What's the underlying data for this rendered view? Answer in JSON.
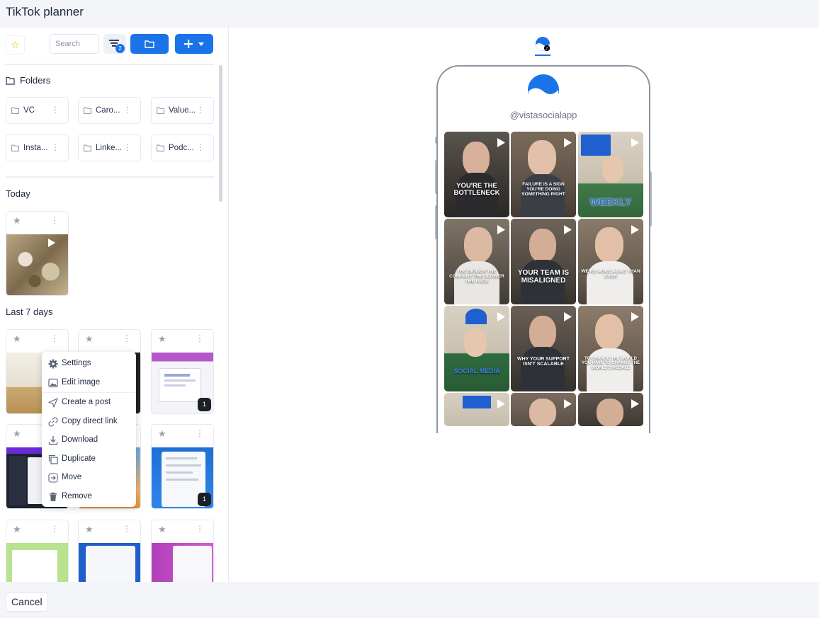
{
  "window": {
    "title": "TikTok planner"
  },
  "toolbar": {
    "search_placeholder": "Search",
    "filter_count": "2"
  },
  "folders_section": {
    "title": "Folders",
    "items": [
      {
        "name": "VC"
      },
      {
        "name": "Caro..."
      },
      {
        "name": "Value..."
      },
      {
        "name": "Insta..."
      },
      {
        "name": "Linke..."
      },
      {
        "name": "Podc..."
      }
    ]
  },
  "today_section": {
    "title": "Today"
  },
  "last7_section": {
    "title": "Last 7 days",
    "badges": [
      "1",
      "1"
    ]
  },
  "context_menu": {
    "items": [
      {
        "label": "Settings",
        "icon": "gear-icon"
      },
      {
        "label": "Edit image",
        "icon": "image-icon"
      },
      {
        "label": "Create a post",
        "icon": "send-icon"
      },
      {
        "label": "Copy direct link",
        "icon": "link-icon"
      },
      {
        "label": "Download",
        "icon": "download-icon"
      },
      {
        "label": "Duplicate",
        "icon": "duplicate-icon"
      },
      {
        "label": "Move",
        "icon": "move-icon"
      },
      {
        "label": "Remove",
        "icon": "trash-icon"
      }
    ]
  },
  "preview": {
    "handle": "@vistasocialapp",
    "tiles": [
      {
        "caption": "YOU'RE THE BOTTLENECK"
      },
      {
        "caption": "FAILURE IS A SIGN YOU'RE DOING SOMETHING RIGHT"
      },
      {
        "caption": "WEEKLY"
      },
      {
        "caption": "THE BIGGER THE COMPANY THE SLOWER THE PACE"
      },
      {
        "caption": "YOUR TEAM IS MISALIGNED"
      },
      {
        "caption": "WE'RE MORE ALIKE THAN EVER"
      },
      {
        "caption": "SOCIAL MEDIA"
      },
      {
        "caption": "WHY YOUR SUPPORT ISN'T SCALABLE"
      },
      {
        "caption": "TO CHANGE THE WORLD YOU HAVE TO CHANGE THE WORLD'S PEOPLE"
      },
      {
        "caption": ""
      },
      {
        "caption": ""
      },
      {
        "caption": ""
      }
    ]
  },
  "footer": {
    "cancel_label": "Cancel"
  },
  "colors": {
    "accent": "#1a73e8",
    "star": "#f0b400"
  }
}
